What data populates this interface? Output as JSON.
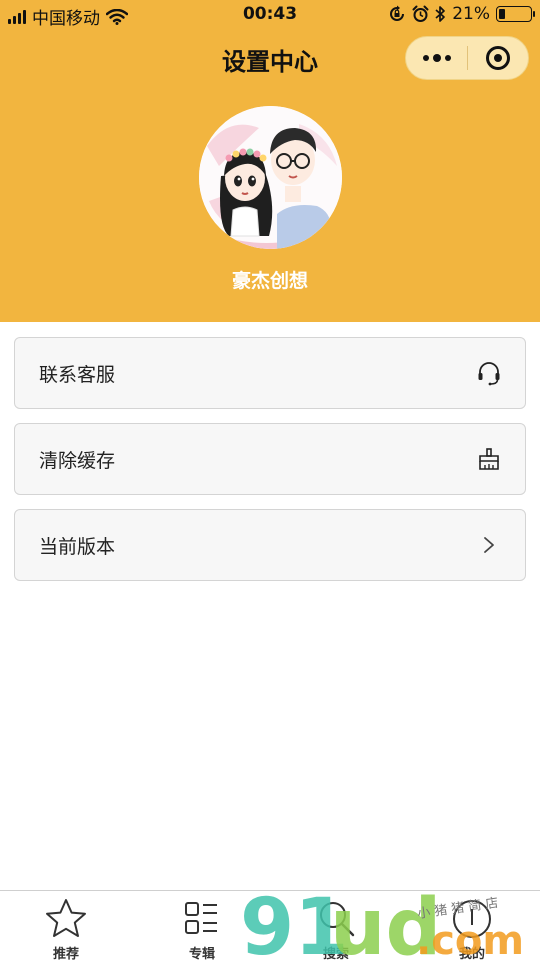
{
  "status_bar": {
    "carrier": "中国移动",
    "time": "00:43",
    "battery": "21%",
    "battery_level": 0.21
  },
  "nav": {
    "title": "设置中心",
    "capsule_icons": [
      "more-icon",
      "close-miniprogram-icon"
    ]
  },
  "profile": {
    "name": "豪杰创想",
    "avatar_icon": "couple-cartoon-avatar"
  },
  "menu": [
    {
      "label": "联系客服",
      "icon": "headset-icon"
    },
    {
      "label": "清除缓存",
      "icon": "clear-cache-icon"
    },
    {
      "label": "当前版本",
      "icon": "chevron-right-icon"
    }
  ],
  "tabbar": [
    {
      "label": "推荐",
      "icon": "star-icon"
    },
    {
      "label": "专辑",
      "icon": "album-list-icon"
    },
    {
      "label": "搜索",
      "icon": "search-icon"
    },
    {
      "label": "我的",
      "icon": "profile-icon"
    }
  ],
  "watermark": {
    "logo": "91ud.com",
    "sub": "小猪猪简店"
  },
  "colors": {
    "header_bg": "#f2b53f",
    "capsule_bg": "#fbe7b2",
    "menu_bg": "#f7f7f7",
    "menu_border": "#d4d4d4"
  }
}
